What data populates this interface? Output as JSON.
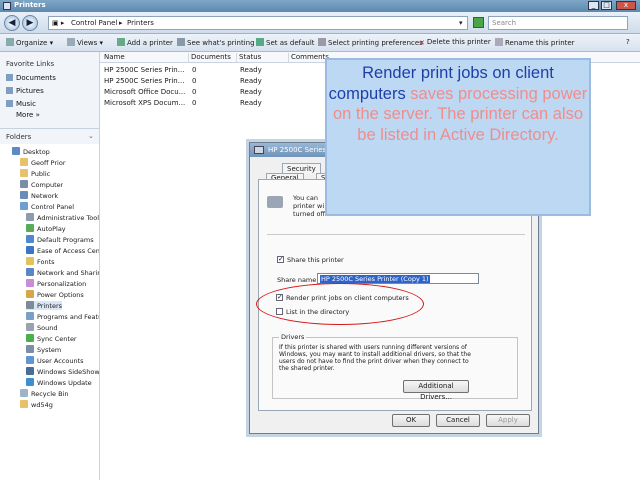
{
  "window": {
    "title": "Printers"
  },
  "address": {
    "parts": [
      "Control Panel",
      "Printers"
    ],
    "search_placeholder": "Search"
  },
  "toolbar": {
    "items": [
      "Organize",
      "Views",
      "Add a printer",
      "See what's printing",
      "Set as default",
      "Select printing preferences",
      "Delete this printer",
      "Rename this printer"
    ]
  },
  "leftnav": {
    "favorites_heading": "Favorite Links",
    "favorites": [
      "Documents",
      "Pictures",
      "Music"
    ],
    "more": "More »",
    "folders_heading": "Folders",
    "tree": [
      "Desktop",
      "Geoff Prior",
      "Public",
      "Computer",
      "Network",
      "Control Panel",
      "Administrative Tools",
      "AutoPlay",
      "Default Programs",
      "Ease of Access Center",
      "Fonts",
      "Network and Sharing Center",
      "Personalization",
      "Power Options",
      "Printers",
      "Programs and Features",
      "Sound",
      "Sync Center",
      "System",
      "User Accounts",
      "Windows SideShow",
      "Windows Update",
      "Recycle Bin",
      "wd54g"
    ]
  },
  "list": {
    "columns": [
      "Name",
      "Documents",
      "Status",
      "Comments"
    ],
    "rows": [
      {
        "name": "HP 2500C Series Prin...",
        "docs": "0",
        "status": "Ready"
      },
      {
        "name": "HP 2500C Series Prin...",
        "docs": "0",
        "status": "Ready"
      },
      {
        "name": "Microsoft Office Docu...",
        "docs": "0",
        "status": "Ready"
      },
      {
        "name": "Microsoft XPS Docum...",
        "docs": "0",
        "status": "Ready"
      }
    ]
  },
  "dialog": {
    "title": "HP 2500C Series",
    "tabs": [
      "Security",
      "General",
      "S"
    ],
    "info_lines": [
      "You can",
      "printer wi",
      "turned off."
    ],
    "share_label": "Share this printer",
    "share_name_label": "Share name:",
    "share_name_value": "HP 2500C Series Printer (Copy 1)",
    "render_label": "Render print jobs on client computers",
    "list_label": "List in the directory",
    "drivers_heading": "Drivers",
    "drivers_text": [
      "If this printer is shared with users running different versions of",
      "Windows, you may want to install additional drivers, so that the",
      "users do not have to find the print driver when they connect to",
      "the shared printer."
    ],
    "additional_drivers": "Additional Drivers...",
    "ok": "OK",
    "cancel": "Cancel",
    "apply": "Apply"
  },
  "callout": {
    "part1": "Render print jobs on client computers",
    "part2": "saves processing power on the server. The printer can also be listed in Active Directory."
  },
  "colors": {
    "callout_blue": "#1f3fa8",
    "callout_pink": "#ef8d8d",
    "ellipse": "#d51818"
  }
}
